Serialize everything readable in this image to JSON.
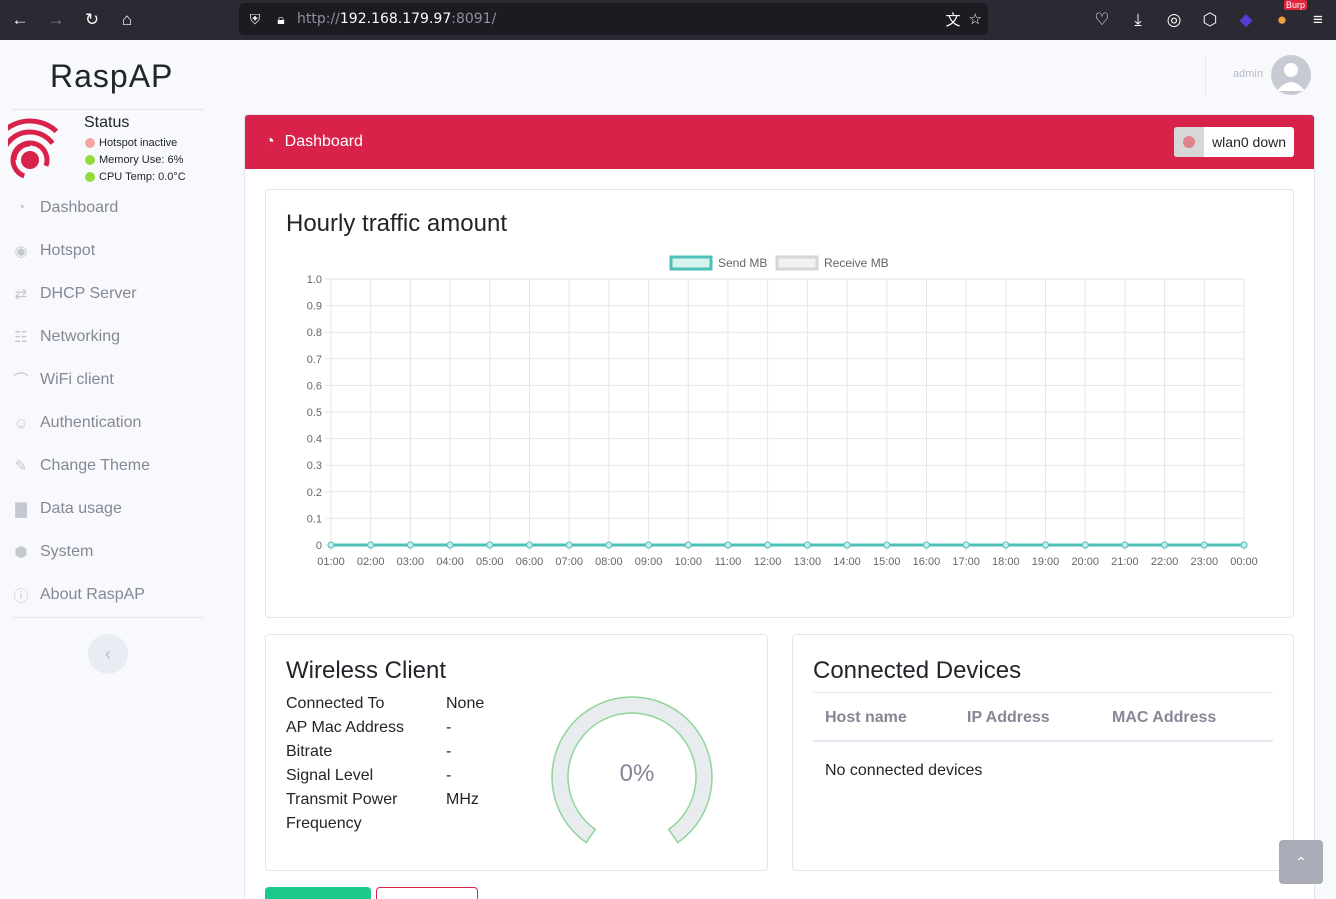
{
  "browser": {
    "url_prefix": "http://",
    "url_host": "192.168.179.97",
    "url_suffix": ":8091/",
    "burp_tag": "Burp"
  },
  "sidebar": {
    "brand": "RaspAP",
    "status": {
      "title": "Status",
      "items": [
        {
          "label": "Hotspot inactive",
          "color": "#f4a3a3"
        },
        {
          "label": "Memory Use: 6%",
          "color": "#8fdc3a"
        },
        {
          "label": "CPU Temp: 0.0°C",
          "color": "#8fdc3a"
        }
      ]
    },
    "menu": [
      {
        "label": "Dashboard",
        "icon": "tachometer-icon"
      },
      {
        "label": "Hotspot",
        "icon": "dot-circle-icon"
      },
      {
        "label": "DHCP Server",
        "icon": "exchange-icon"
      },
      {
        "label": "Networking",
        "icon": "network-icon"
      },
      {
        "label": "WiFi client",
        "icon": "wifi-icon"
      },
      {
        "label": "Authentication",
        "icon": "user-lock-icon"
      },
      {
        "label": "Change Theme",
        "icon": "paint-brush-icon"
      },
      {
        "label": "Data usage",
        "icon": "bar-chart-icon"
      },
      {
        "label": "System",
        "icon": "cube-icon"
      },
      {
        "label": "About RaspAP",
        "icon": "info-circle-icon"
      }
    ]
  },
  "topbar": {
    "user": "admin"
  },
  "dashboard": {
    "header_title": "Dashboard",
    "interface_status": "wlan0 down"
  },
  "chart_data": {
    "type": "line",
    "title": "Hourly traffic amount",
    "legend": [
      "Send MB",
      "Receive MB"
    ],
    "legend_position": "top",
    "x": [
      "01:00",
      "02:00",
      "03:00",
      "04:00",
      "05:00",
      "06:00",
      "07:00",
      "08:00",
      "09:00",
      "10:00",
      "11:00",
      "12:00",
      "13:00",
      "14:00",
      "15:00",
      "16:00",
      "17:00",
      "18:00",
      "19:00",
      "20:00",
      "21:00",
      "22:00",
      "23:00",
      "00:00"
    ],
    "series": [
      {
        "name": "Send MB",
        "color": "#4dc1b8",
        "values": [
          0,
          0,
          0,
          0,
          0,
          0,
          0,
          0,
          0,
          0,
          0,
          0,
          0,
          0,
          0,
          0,
          0,
          0,
          0,
          0,
          0,
          0,
          0,
          0
        ]
      },
      {
        "name": "Receive MB",
        "color": "#d6d6d6",
        "values": [
          0,
          0,
          0,
          0,
          0,
          0,
          0,
          0,
          0,
          0,
          0,
          0,
          0,
          0,
          0,
          0,
          0,
          0,
          0,
          0,
          0,
          0,
          0,
          0
        ]
      }
    ],
    "ylim": [
      0,
      1.0
    ],
    "yticks": [
      "0",
      "0.1",
      "0.2",
      "0.3",
      "0.4",
      "0.5",
      "0.6",
      "0.7",
      "0.8",
      "0.9",
      "1.0"
    ],
    "grid": true
  },
  "wireless_client": {
    "title": "Wireless Client",
    "rows": [
      {
        "label": "Connected To",
        "value": "None"
      },
      {
        "label": "AP Mac Address",
        "value": "-"
      },
      {
        "label": "Bitrate",
        "value": "-"
      },
      {
        "label": "Signal Level",
        "value": "-"
      },
      {
        "label": "Transmit Power",
        "value": "MHz"
      },
      {
        "label": "Frequency",
        "value": ""
      }
    ],
    "signal_percent": 0,
    "signal_label": "0%"
  },
  "connected_devices": {
    "title": "Connected Devices",
    "columns": [
      "Host name",
      "IP Address",
      "MAC Address"
    ],
    "empty_text": "No connected devices"
  }
}
